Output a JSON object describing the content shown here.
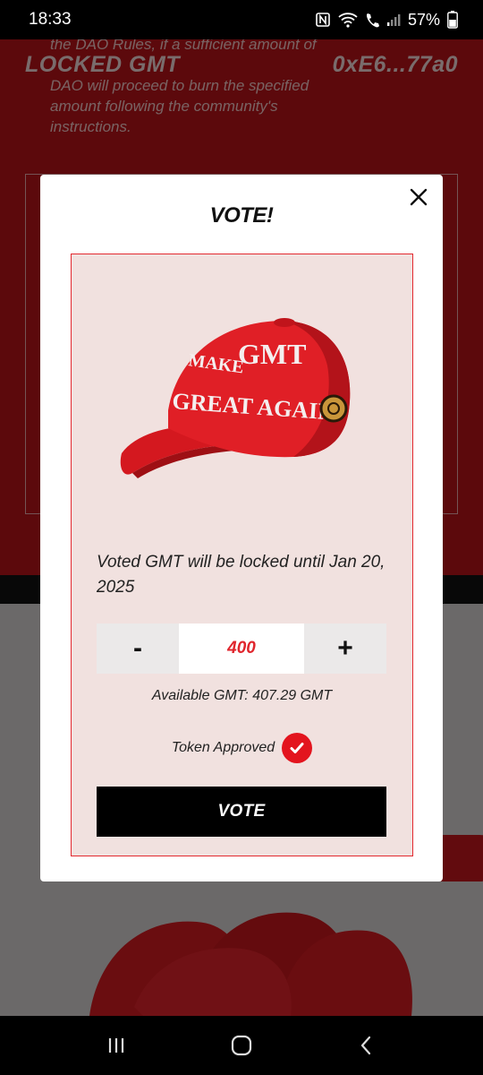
{
  "status": {
    "time": "18:33",
    "battery": "57%"
  },
  "background": {
    "header_left": "LOCKED GMT",
    "header_right": "0xE6...77a0",
    "body_lines": [
      "the DAO Rules, if a sufficient amount of",
      "DAO will proceed to burn the specified",
      "amount following the community's",
      "instructions."
    ]
  },
  "modal": {
    "title": "VOTE!",
    "close_icon": "close-icon",
    "image_caption_lines": [
      "MAKE",
      "GMT",
      "GREAT AGAIN"
    ],
    "lock_text": "Voted GMT will be locked until Jan 20, 2025",
    "stepper": {
      "minus_label": "-",
      "value": "400",
      "plus_label": "+"
    },
    "available": "Available GMT: 407.29 GMT",
    "approved_label": "Token Approved",
    "vote_label": "VOTE",
    "accent": "#e3141e"
  },
  "nav": {
    "recent_icon": "recent-apps-icon",
    "home_icon": "home-icon",
    "back_icon": "back-icon"
  }
}
